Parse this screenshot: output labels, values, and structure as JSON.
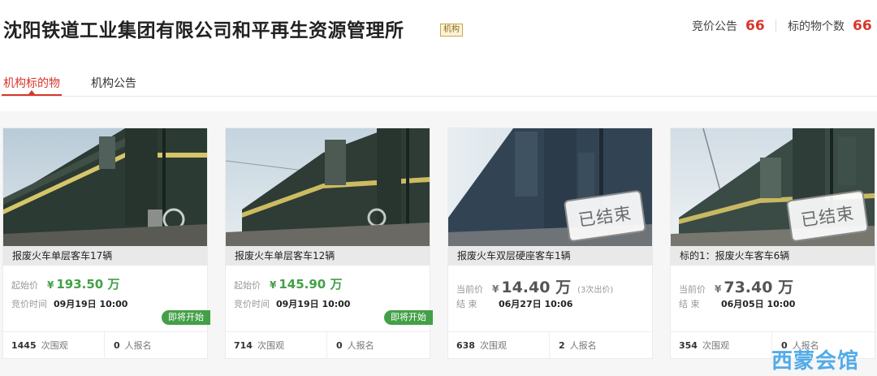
{
  "header": {
    "org_name": "沈阳铁道工业集团有限公司和平再生资源管理所",
    "org_badge": "机构",
    "stats": [
      {
        "label": "竞价公告",
        "value": "66"
      },
      {
        "label": "标的物个数",
        "value": "66"
      }
    ]
  },
  "tabs": [
    {
      "label": "机构标的物",
      "active": true
    },
    {
      "label": "机构公告",
      "active": false
    }
  ],
  "cards": [
    {
      "title": "报废火车单层客车17辆",
      "price_label": "起始价",
      "currency": "¥",
      "price": "193.50 万",
      "time_label": "竞价时间",
      "time": "09月19日 10:00",
      "badge": "即将开始",
      "views": "1445",
      "views_label": "次围观",
      "signups": "0",
      "signups_label": "人报名"
    },
    {
      "title": "报废火车单层客车12辆",
      "price_label": "起始价",
      "currency": "¥",
      "price": "145.90 万",
      "time_label": "竞价时间",
      "time": "09月19日 10:00",
      "badge": "即将开始",
      "views": "714",
      "views_label": "次围观",
      "signups": "0",
      "signups_label": "人报名"
    },
    {
      "title": "报废火车双层硬座客车1辆",
      "price_label": "当前价",
      "currency": "¥",
      "price": "14.40 万",
      "bid_count": "(3次出价)",
      "time_label": "结 束",
      "time": "06月27日 10:06",
      "stamp": "已结束",
      "views": "638",
      "views_label": "次围观",
      "signups": "2",
      "signups_label": "人报名"
    },
    {
      "title": "标的1：报废火车客车6辆",
      "price_label": "当前价",
      "currency": "¥",
      "price": "73.40 万",
      "time_label": "结 束",
      "time": "06月05日 10:00",
      "stamp": "已结束",
      "views": "354",
      "views_label": "次围观",
      "signups": "0",
      "signups_label": "人报名"
    }
  ],
  "watermark": "西蒙会馆",
  "colors": {
    "accent_red": "#d8362a",
    "price_green": "#43a047",
    "train_green": "#2c3b33",
    "watermark_blue": "#4aa8e8"
  }
}
